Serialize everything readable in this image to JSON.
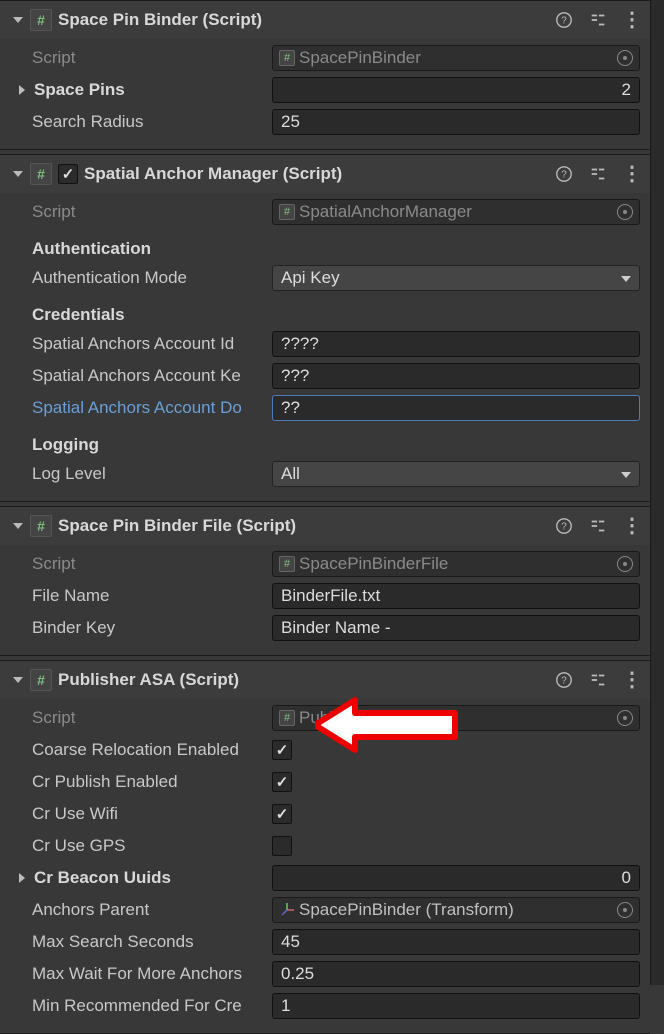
{
  "components": {
    "spacePinBinder": {
      "title": "Space Pin Binder (Script)",
      "scriptLabel": "Script",
      "scriptValue": "SpacePinBinder",
      "spacePinsLabel": "Space Pins",
      "spacePinsCount": "2",
      "searchRadiusLabel": "Search Radius",
      "searchRadiusValue": "25"
    },
    "spatialAnchorManager": {
      "title": "Spatial Anchor Manager (Script)",
      "scriptLabel": "Script",
      "scriptValue": "SpatialAnchorManager",
      "authSection": "Authentication",
      "authModeLabel": "Authentication Mode",
      "authModeValue": "Api Key",
      "credSection": "Credentials",
      "accIdLabel": "Spatial Anchors Account Id",
      "accIdValue": "????",
      "accKeyLabel": "Spatial Anchors Account Ke",
      "accKeyValue": "???",
      "accDomLabel": "Spatial Anchors Account Do",
      "accDomValue": "??",
      "logSection": "Logging",
      "logLevelLabel": "Log Level",
      "logLevelValue": "All"
    },
    "spacePinBinderFile": {
      "title": "Space Pin Binder File (Script)",
      "scriptLabel": "Script",
      "scriptValue": "SpacePinBinderFile",
      "fileNameLabel": "File Name",
      "fileNameValue": "BinderFile.txt",
      "binderKeyLabel": "Binder Key",
      "binderKeyValue": "Binder Name -"
    },
    "publisherASA": {
      "title": "Publisher ASA (Script)",
      "scriptLabel": "Script",
      "scriptValue": "PublisherASA",
      "coarseRelocLabel": "Coarse Relocation Enabled",
      "crPublishLabel": "Cr Publish Enabled",
      "crWifiLabel": "Cr Use Wifi",
      "crGpsLabel": "Cr Use GPS",
      "crBeaconLabel": "Cr Beacon Uuids",
      "crBeaconCount": "0",
      "anchorsParentLabel": "Anchors Parent",
      "anchorsParentValue": "SpacePinBinder (Transform)",
      "maxSearchLabel": "Max Search Seconds",
      "maxSearchValue": "45",
      "maxWaitLabel": "Max Wait For More Anchors",
      "maxWaitValue": "0.25",
      "minRecLabel": "Min Recommended For Cre",
      "minRecValue": "1"
    }
  },
  "checkboxes": {
    "spatialAnchorManagerEnabled": true,
    "coarseReloc": true,
    "crPublish": true,
    "crWifi": true,
    "crGps": false
  },
  "icons": {
    "hash": "#"
  }
}
